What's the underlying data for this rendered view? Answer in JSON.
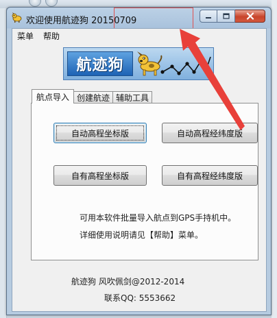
{
  "window": {
    "title": "欢迎使用航迹狗  20150709"
  },
  "menu": {
    "items": [
      "菜单",
      "帮助"
    ]
  },
  "logo": {
    "text": "航迹狗"
  },
  "tabs": [
    {
      "label": "航点导入",
      "active": true
    },
    {
      "label": "创建航迹",
      "active": false
    },
    {
      "label": "辅助工具",
      "active": false
    }
  ],
  "buttons": {
    "auto_elev_coord": "自动高程坐标版",
    "auto_elev_latlon": "自动高程经纬度版",
    "own_elev_coord": "自有高程坐标版",
    "own_elev_latlon": "自有高程经纬度版"
  },
  "info": {
    "line1": "可用本软件批量导入航点到GPS手持机中。",
    "line2": "详细使用说明请见【帮助】菜单。"
  },
  "footer": {
    "line1": "航迹狗   风吹佩剑@2012-2014",
    "line2": "联系QQ: 5553662"
  },
  "colors": {
    "annotation": "#e8403a",
    "title_bar": "#b6cbe0",
    "close_button": "#c8442b",
    "logo_blue": "#1d63b5"
  }
}
